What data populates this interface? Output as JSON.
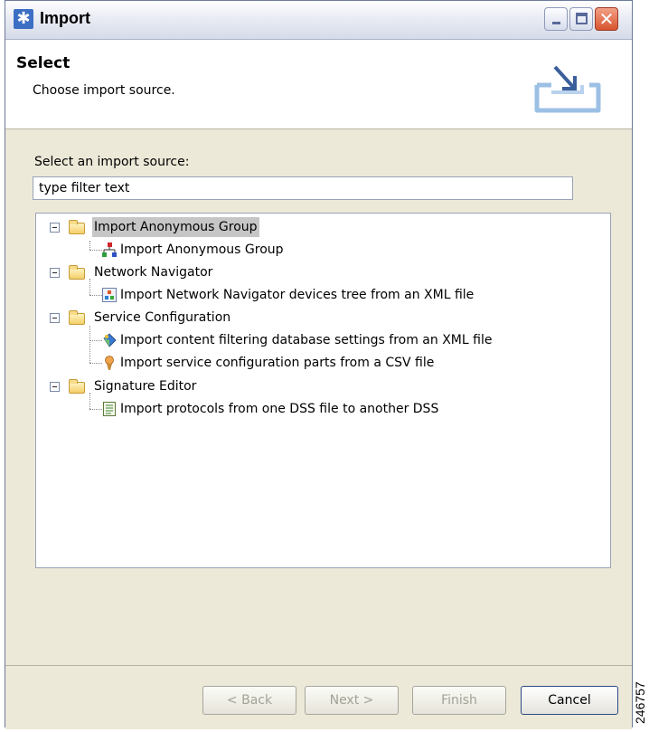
{
  "window": {
    "title": "Import"
  },
  "header": {
    "title": "Select",
    "description": "Choose import source."
  },
  "filter": {
    "label": "Select an import source:",
    "value": "type filter text"
  },
  "tree": {
    "groups": [
      {
        "label": "Import Anonymous Group",
        "selected": true,
        "expanded": true,
        "children": [
          {
            "label": "Import Anonymous Group",
            "icon": "hierarchy-icon"
          }
        ]
      },
      {
        "label": "Network Navigator",
        "selected": false,
        "expanded": true,
        "children": [
          {
            "label": "Import Network Navigator devices tree from an XML file",
            "icon": "network-navigator-icon"
          }
        ]
      },
      {
        "label": "Service Configuration",
        "selected": false,
        "expanded": true,
        "children": [
          {
            "label": "Import content filtering database settings from an XML file",
            "icon": "content-filter-icon"
          },
          {
            "label": "Import service configuration parts from a CSV file",
            "icon": "service-config-icon"
          }
        ]
      },
      {
        "label": "Signature Editor",
        "selected": false,
        "expanded": true,
        "children": [
          {
            "label": "Import protocols from one DSS file to another DSS",
            "icon": "document-icon"
          }
        ]
      }
    ]
  },
  "buttons": {
    "back": "< Back",
    "next": "Next >",
    "finish": "Finish",
    "cancel": "Cancel"
  },
  "watermark": "246757",
  "colors": {
    "selection": "#c6c6c6",
    "window_bg": "#ece9d8",
    "close_button": "#d8532e"
  }
}
